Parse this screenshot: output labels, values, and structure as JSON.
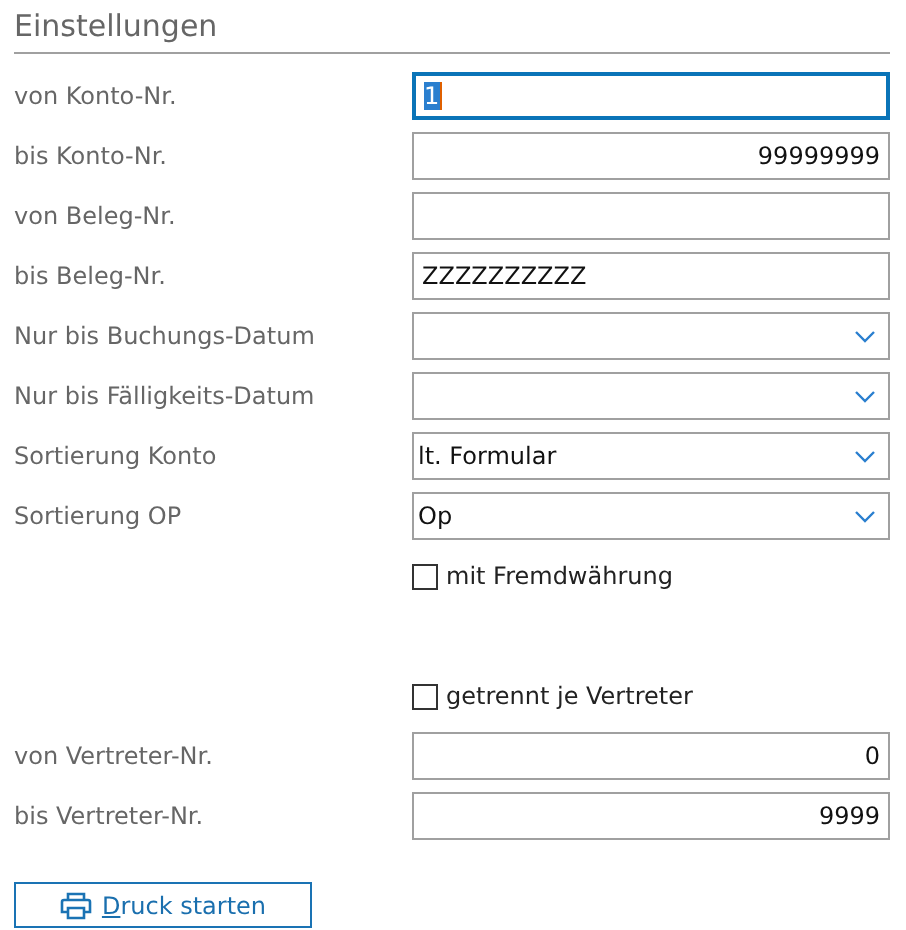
{
  "section": {
    "title": "Einstellungen"
  },
  "rows": [
    {
      "kind": "text",
      "label": "von Konto-Nr.",
      "value": "1",
      "focused": true
    },
    {
      "kind": "number",
      "label": "bis Konto-Nr.",
      "value": "99999999",
      "focused": false
    },
    {
      "kind": "text",
      "label": "von Beleg-Nr.",
      "focused": false
    },
    {
      "kind": "text",
      "label": "bis Beleg-Nr.",
      "value": "ZZZZZZZZZZ",
      "focused": false
    },
    {
      "kind": "dropdown",
      "label": "Nur bis Buchungs-Datum"
    },
    {
      "kind": "dropdown",
      "label": "Nur bis Fälligkeits-Datum"
    },
    {
      "kind": "dropdown",
      "label": "Sortierung Konto",
      "value": "lt. Formular"
    },
    {
      "kind": "dropdown",
      "label": "Sortierung OP",
      "value": "Op"
    },
    {
      "kind": "checkbox",
      "text": "mit Fremdwährung",
      "checked": false
    },
    {
      "kind": "checkbox",
      "text": "getrennt je Vertreter",
      "checked": false
    },
    {
      "kind": "number",
      "label": "von Vertreter-Nr.",
      "value": "0",
      "focused": false
    },
    {
      "kind": "number",
      "label": "bis Vertreter-Nr.",
      "value": "9999",
      "focused": false
    }
  ],
  "print_button": {
    "label": "Druck starten"
  }
}
